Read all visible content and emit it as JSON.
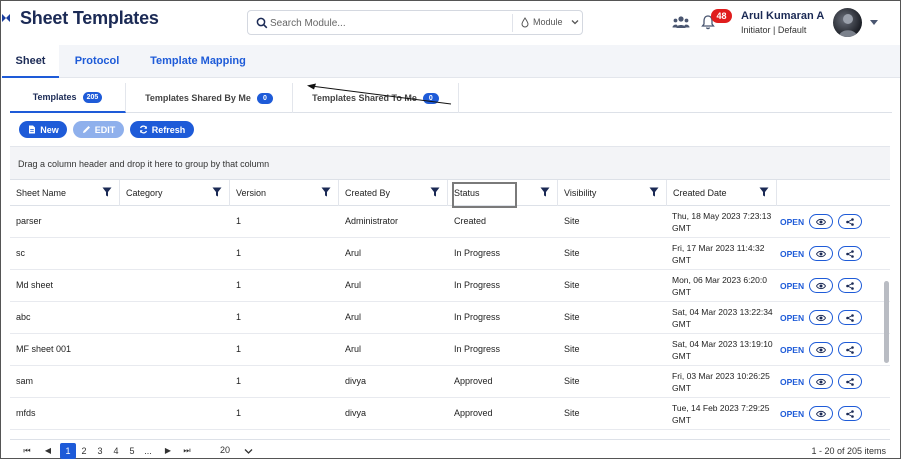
{
  "header": {
    "title": "Sheet Templates",
    "search_placeholder": "Search Module...",
    "module_label": "Module",
    "notification_count": "48",
    "user_name": "Arul Kumaran A",
    "user_role": "Initiator | Default"
  },
  "main_tabs": [
    "Sheet",
    "Protocol",
    "Template Mapping"
  ],
  "sub_tabs": [
    {
      "label": "Templates",
      "count": "205"
    },
    {
      "label": "Templates Shared By Me",
      "count": "0"
    },
    {
      "label": "Templates Shared To Me",
      "count": "0"
    }
  ],
  "toolbar": {
    "new_label": "New",
    "edit_label": "EDIT",
    "refresh_label": "Refresh"
  },
  "group_hint": "Drag a column header and drop it here to group by that column",
  "columns": [
    "Sheet Name",
    "Category",
    "Version",
    "Created By",
    "Status",
    "Visibility",
    "Created Date"
  ],
  "open_label": "OPEN",
  "rows": [
    {
      "sheet_name": "parser",
      "category": "",
      "version": "1",
      "created_by": "Administrator",
      "status": "Created",
      "visibility": "Site",
      "created_date_1": "Thu, 18 May 2023 7:23:13",
      "created_date_2": "GMT"
    },
    {
      "sheet_name": "sc",
      "category": "",
      "version": "1",
      "created_by": "Arul",
      "status": "In Progress",
      "visibility": "Site",
      "created_date_1": "Fri, 17 Mar 2023 11:4:32",
      "created_date_2": "GMT"
    },
    {
      "sheet_name": "Md sheet",
      "category": "",
      "version": "1",
      "created_by": "Arul",
      "status": "In Progress",
      "visibility": "Site",
      "created_date_1": "Mon, 06 Mar 2023 6:20:0",
      "created_date_2": "GMT"
    },
    {
      "sheet_name": "abc",
      "category": "",
      "version": "1",
      "created_by": "Arul",
      "status": "In Progress",
      "visibility": "Site",
      "created_date_1": "Sat, 04 Mar 2023 13:22:34",
      "created_date_2": "GMT"
    },
    {
      "sheet_name": "MF sheet 001",
      "category": "",
      "version": "1",
      "created_by": "Arul",
      "status": "In Progress",
      "visibility": "Site",
      "created_date_1": "Sat, 04 Mar 2023 13:19:10",
      "created_date_2": "GMT"
    },
    {
      "sheet_name": "sam",
      "category": "",
      "version": "1",
      "created_by": "divya",
      "status": "Approved",
      "visibility": "Site",
      "created_date_1": "Fri, 03 Mar 2023 10:26:25",
      "created_date_2": "GMT"
    },
    {
      "sheet_name": "mfds",
      "category": "",
      "version": "1",
      "created_by": "divya",
      "status": "Approved",
      "visibility": "Site",
      "created_date_1": "Tue, 14 Feb 2023 7:29:25",
      "created_date_2": "GMT"
    }
  ],
  "pager": {
    "pages": [
      "1",
      "2",
      "3",
      "4",
      "5",
      "..."
    ],
    "current_page": "1",
    "page_size": "20",
    "info": "1 - 20 of 205 items"
  },
  "colors": {
    "accent": "#1e5bd8",
    "title": "#1b2a55",
    "badge": "#e01d1d"
  }
}
